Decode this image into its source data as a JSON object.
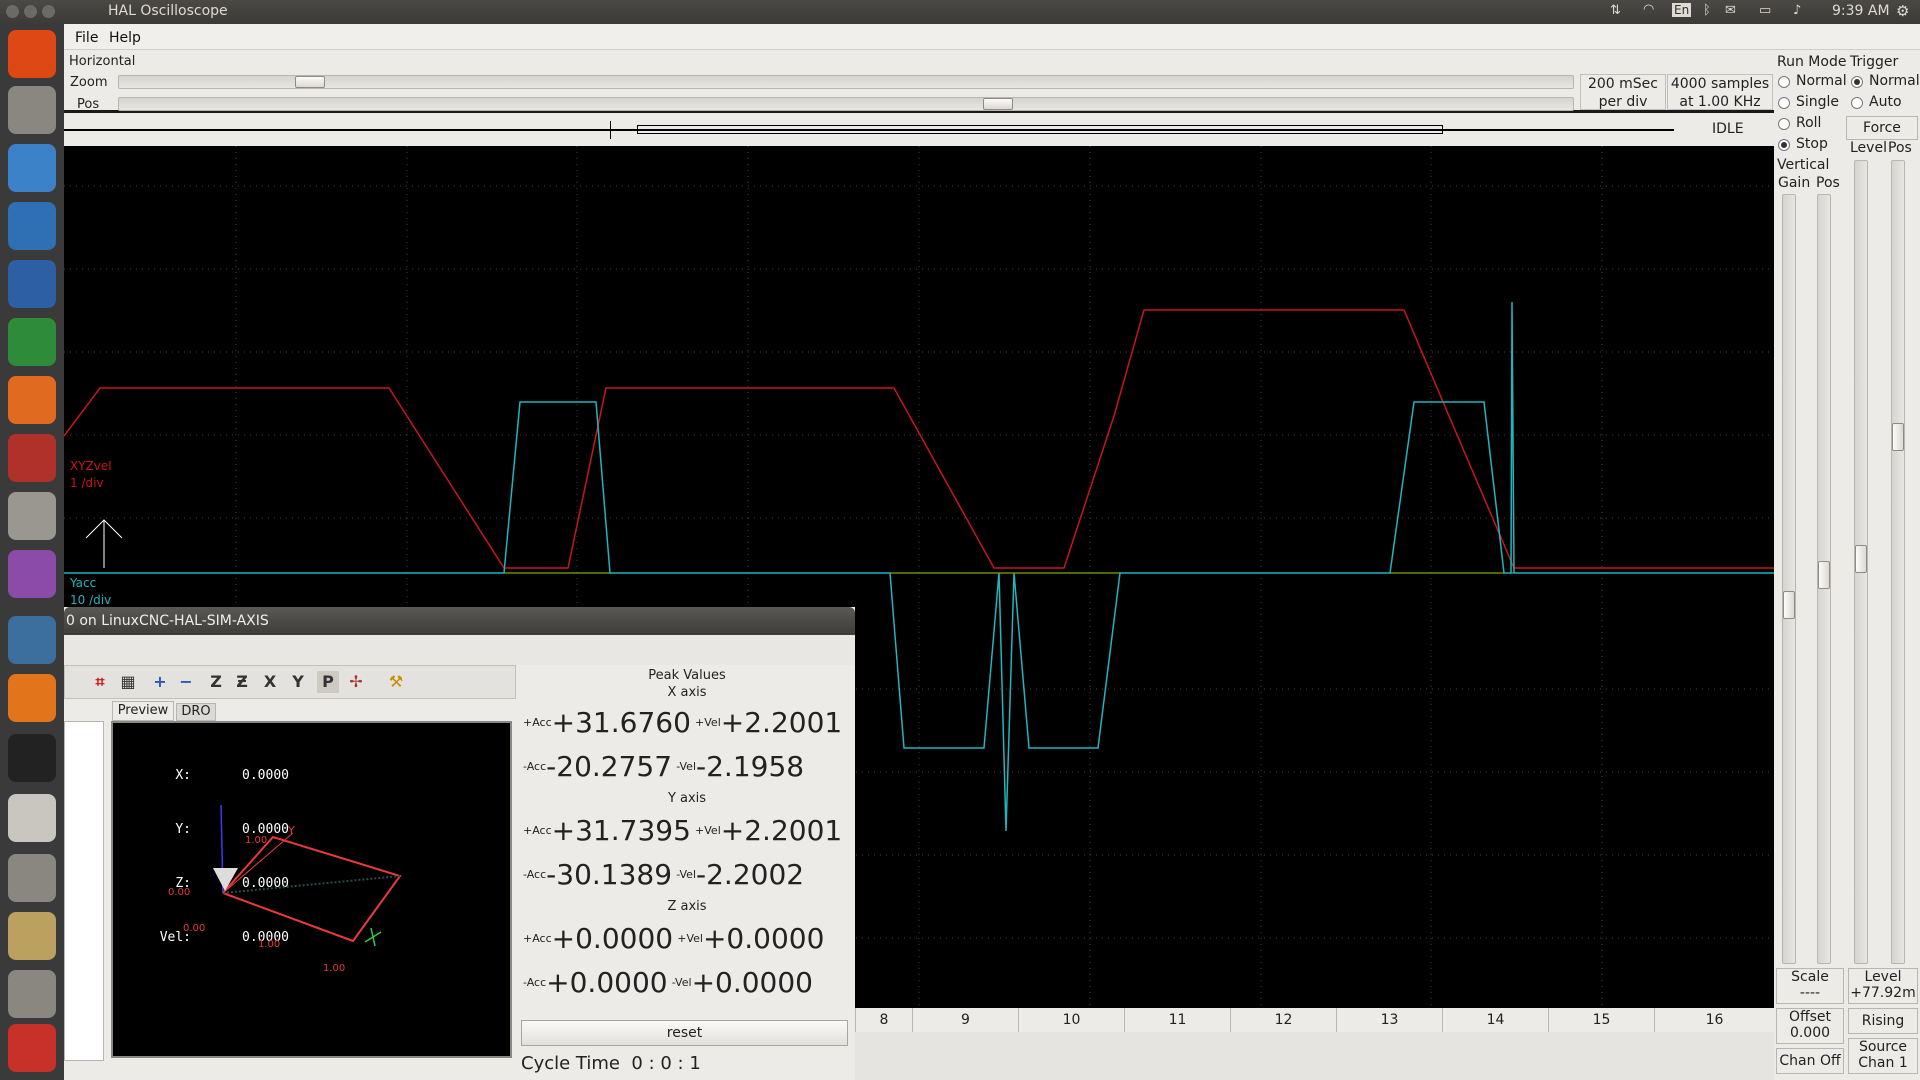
{
  "window_title": "HAL Oscilloscope",
  "topbar": {
    "clock": "9:39 AM",
    "lang": "En"
  },
  "menu": {
    "file": "File",
    "help": "Help"
  },
  "horizontal": {
    "label": "Horizontal",
    "zoom_label": "Zoom",
    "pos_label": "Pos",
    "rate_line1": "200 mSec",
    "rate_line2": "per div",
    "samples_line1": "4000 samples",
    "samples_line2": "at 1.00 KHz",
    "state": "IDLE"
  },
  "run_mode": {
    "title": "Run Mode",
    "options": [
      "Normal",
      "Single",
      "Roll",
      "Stop"
    ],
    "selected": "Stop"
  },
  "trigger": {
    "title": "Trigger",
    "options": [
      "Normal",
      "Auto"
    ],
    "selected": "Normal",
    "force": "Force",
    "level_label": "Level",
    "pos_label": "Pos",
    "level_title": "Level",
    "level_value": "+77.92m",
    "edge": "Rising",
    "source_line1": "Source",
    "source_line2": "Chan 1"
  },
  "vertical": {
    "title": "Vertical",
    "gain_label": "Gain",
    "pos_label": "Pos",
    "scale_label": "Scale",
    "scale_value": "----",
    "offset_label": "Offset",
    "offset_value": "0.000",
    "chan_off": "Chan Off"
  },
  "channels": [
    {
      "name": "XYZvel",
      "scale": "1 /div",
      "color": "#c8161d"
    },
    {
      "name": "Yacc",
      "scale": "10 /div",
      "color": "#21b5c0"
    }
  ],
  "x_ticks": [
    "8",
    "9",
    "10",
    "11",
    "12",
    "13",
    "14",
    "15",
    "16"
  ],
  "axis_window": {
    "title": "0 on LinuxCNC-HAL-SIM-AXIS",
    "tabs": [
      "Preview",
      "DRO"
    ],
    "dro": [
      {
        "axis": "X:",
        "value": "0.0000"
      },
      {
        "axis": "Y:",
        "value": "0.0000"
      },
      {
        "axis": "Z:",
        "value": "0.0000"
      },
      {
        "axis": "Vel:",
        "value": "0.0000"
      }
    ],
    "grid_labels": [
      "1.00",
      "0.00",
      "0.00",
      "1.00",
      "1.00"
    ],
    "peak_title": "Peak Values",
    "axes": [
      {
        "name": "X axis",
        "pos_acc": "+31.6760",
        "pos_vel": "+2.2001",
        "neg_acc": "-20.2757",
        "neg_vel": "-2.1958"
      },
      {
        "name": "Y axis",
        "pos_acc": "+31.7395",
        "pos_vel": "+2.2001",
        "neg_acc": "-30.1389",
        "neg_vel": "-2.2002"
      },
      {
        "name": "Z axis",
        "pos_acc": "+0.0000",
        "pos_vel": "+0.0000",
        "neg_acc": "+0.0000",
        "neg_vel": "+0.0000"
      }
    ],
    "lbl_pacc": "+Acc",
    "lbl_pvel": "+Vel",
    "lbl_nacc": "-Acc",
    "lbl_nvel": "-Vel",
    "reset": "reset",
    "cycle_time": "Cycle Time  0 : 0 : 1"
  }
}
